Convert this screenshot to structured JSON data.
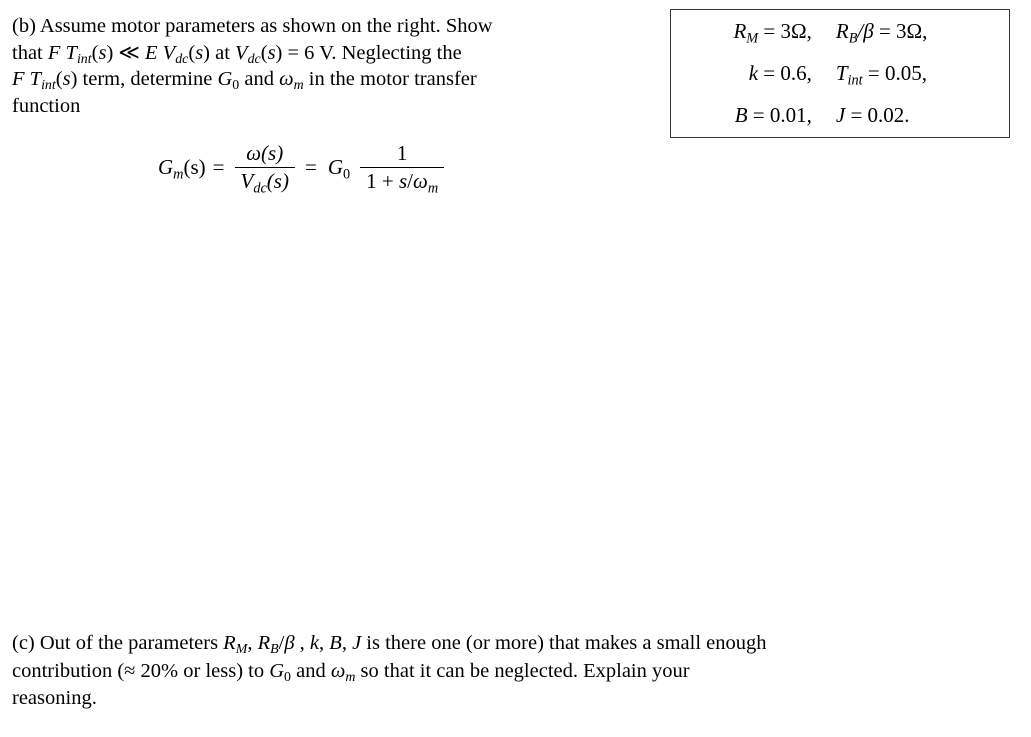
{
  "document": {
    "background_color": "#ffffff",
    "text_color": "#000000"
  },
  "part_b": {
    "label": "(b)",
    "plain_text": "(b) Assume motor parameters as shown on the right. Show that F Tint(s) ≪ E Vdc(s) at Vdc(s) = 6 V. Neglecting the F Tint(s) term, determine G0 and ωm in the motor transfer function",
    "lines": [
      {
        "id": "b-line-1",
        "segments": [
          {
            "text": "(b) Assume motor parameters as shown on the right. Show",
            "style": "upright"
          }
        ]
      },
      {
        "id": "b-line-2",
        "segments": [
          {
            "text": "that ",
            "style": "upright"
          },
          {
            "text": "F",
            "style": "italic"
          },
          {
            "text": " ",
            "style": "upright"
          },
          {
            "text": "T",
            "style": "italic",
            "sub": "int"
          },
          {
            "text": "(",
            "style": "upright"
          },
          {
            "text": "s",
            "style": "italic"
          },
          {
            "text": ") ≪ ",
            "style": "upright"
          },
          {
            "text": "E",
            "style": "italic"
          },
          {
            "text": " ",
            "style": "upright"
          },
          {
            "text": "V",
            "style": "italic",
            "sub": "dc"
          },
          {
            "text": "(",
            "style": "upright"
          },
          {
            "text": "s",
            "style": "italic"
          },
          {
            "text": ") at ",
            "style": "upright"
          },
          {
            "text": "V",
            "style": "italic",
            "sub": "dc"
          },
          {
            "text": "(",
            "style": "upright"
          },
          {
            "text": "s",
            "style": "italic"
          },
          {
            "text": ") = 6 V. Neglecting the",
            "style": "upright"
          }
        ]
      },
      {
        "id": "b-line-3",
        "segments": [
          {
            "text": "F",
            "style": "italic"
          },
          {
            "text": " ",
            "style": "upright"
          },
          {
            "text": "T",
            "style": "italic",
            "sub": "int"
          },
          {
            "text": "(",
            "style": "upright"
          },
          {
            "text": "s",
            "style": "italic"
          },
          {
            "text": ") term, determine ",
            "style": "upright"
          },
          {
            "text": "G",
            "style": "italic",
            "sub": "0"
          },
          {
            "text": " and ",
            "style": "upright"
          },
          {
            "text": "ω",
            "style": "italic",
            "sub": "m"
          },
          {
            "text": " in the motor transfer",
            "style": "upright"
          }
        ]
      },
      {
        "id": "b-line-4",
        "segments": [
          {
            "text": "function",
            "style": "upright"
          }
        ]
      }
    ]
  },
  "equation": {
    "id": "motor-transfer-function",
    "plain_text": "Gm(s) = ω(s) / Vdc(s) = G0 · 1 / (1 + s/ωm)",
    "lhs_symbol": "G",
    "lhs_subscript": "m",
    "lhs_arg": "(s)",
    "equals_1": "=",
    "frac1_numerator": "ω(s)",
    "frac1_denominator": "Vdc(s)",
    "equals_2": "=",
    "gain_symbol": "G",
    "gain_subscript": "0",
    "frac2_numerator": "1",
    "frac2_denominator": "1 + s/ωm"
  },
  "param_box": {
    "id": "motor-parameters",
    "border_color": "#3a3a3a",
    "rows": [
      {
        "left": {
          "symbol": "R",
          "sub": "M",
          "relation": "=",
          "value": "3Ω,"
        },
        "right": {
          "symbol": "R",
          "sub": "B",
          "suffix": "/β",
          "relation": "=",
          "value": "3Ω,"
        }
      },
      {
        "left": {
          "symbol": "k",
          "sub": "",
          "relation": "=",
          "value": "0.6,"
        },
        "right": {
          "symbol": "T",
          "sub": "int",
          "relation": "=",
          "value": "0.05,"
        }
      },
      {
        "left": {
          "symbol": "B",
          "sub": "",
          "relation": "=",
          "value": "0.01,"
        },
        "right": {
          "symbol": "J",
          "sub": "",
          "relation": "=",
          "value": "0.02."
        }
      }
    ],
    "plain_text": "RM = 3Ω,  RB/β = 3Ω,  k = 0.6,  Tint = 0.05,  B = 0.01,  J = 0.02."
  },
  "part_c": {
    "label": "(c)",
    "plain_text": "(c) Out of the parameters RM, RB/β , k, B, J is there one (or more) that makes a small enough contribution (≈ 20% or less) to G0 and ωm so that it can be neglected. Explain your reasoning.",
    "lines": [
      {
        "id": "c-line-1",
        "segments": [
          {
            "text": "(c) Out of the parameters ",
            "style": "upright"
          },
          {
            "text": "R",
            "style": "italic",
            "sub": "M"
          },
          {
            "text": ", ",
            "style": "upright"
          },
          {
            "text": "R",
            "style": "italic",
            "sub": "B"
          },
          {
            "text": "/",
            "style": "upright"
          },
          {
            "text": "β",
            "style": "italic"
          },
          {
            "text": " , ",
            "style": "upright"
          },
          {
            "text": "k",
            "style": "italic"
          },
          {
            "text": ", ",
            "style": "upright"
          },
          {
            "text": "B",
            "style": "italic"
          },
          {
            "text": ", ",
            "style": "upright"
          },
          {
            "text": "J",
            "style": "italic"
          },
          {
            "text": " is there one (or more) that makes a small enough",
            "style": "upright"
          }
        ]
      },
      {
        "id": "c-line-2",
        "segments": [
          {
            "text": "contribution (≈ 20% or less) to ",
            "style": "upright"
          },
          {
            "text": "G",
            "style": "italic",
            "sub": "0"
          },
          {
            "text": " and ",
            "style": "upright"
          },
          {
            "text": "ω",
            "style": "italic",
            "sub": "m"
          },
          {
            "text": " so that it can be neglected. Explain your",
            "style": "upright"
          }
        ]
      },
      {
        "id": "c-line-3",
        "segments": [
          {
            "text": "reasoning.",
            "style": "upright"
          }
        ]
      }
    ]
  }
}
